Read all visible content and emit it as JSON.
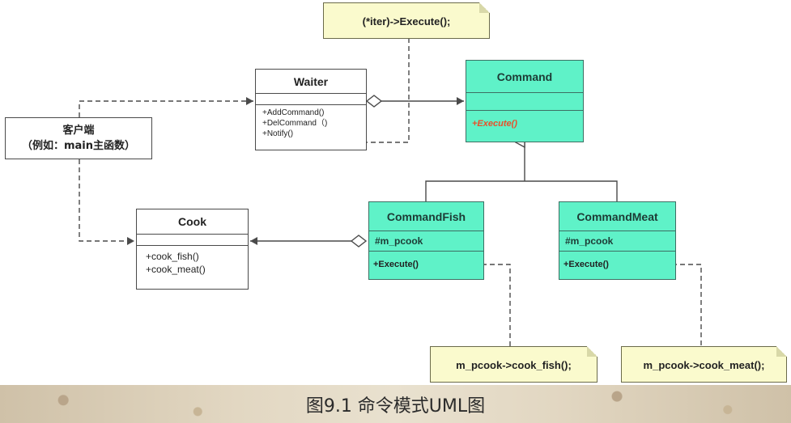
{
  "classes": {
    "waiter": {
      "name": "Waiter",
      "methods": [
        "+AddCommand()",
        "+DelCommand（)",
        "+Notify()"
      ]
    },
    "command": {
      "name": "Command",
      "methods": [
        "+Execute()"
      ]
    },
    "command_fish": {
      "name": "CommandFish",
      "attributes": [
        "#m_pcook"
      ],
      "methods": [
        "+Execute()"
      ]
    },
    "command_meat": {
      "name": "CommandMeat",
      "attributes": [
        "#m_pcook"
      ],
      "methods": [
        "+Execute()"
      ]
    },
    "cook": {
      "name": "Cook",
      "methods": [
        "+cook_fish()",
        "+cook_meat()"
      ]
    }
  },
  "client": {
    "line1": "客户端",
    "line2": "（例如：main主函数）"
  },
  "notes": {
    "iter": "(*iter)->Execute();",
    "fish": "m_pcook->cook_fish();",
    "meat": "m_pcook->cook_meat();"
  },
  "caption": "图9.1  命令模式UML图",
  "colors": {
    "class_fill": "#5ff2c8",
    "note_fill": "#fafacd",
    "abstract_method": "#e8502a"
  }
}
